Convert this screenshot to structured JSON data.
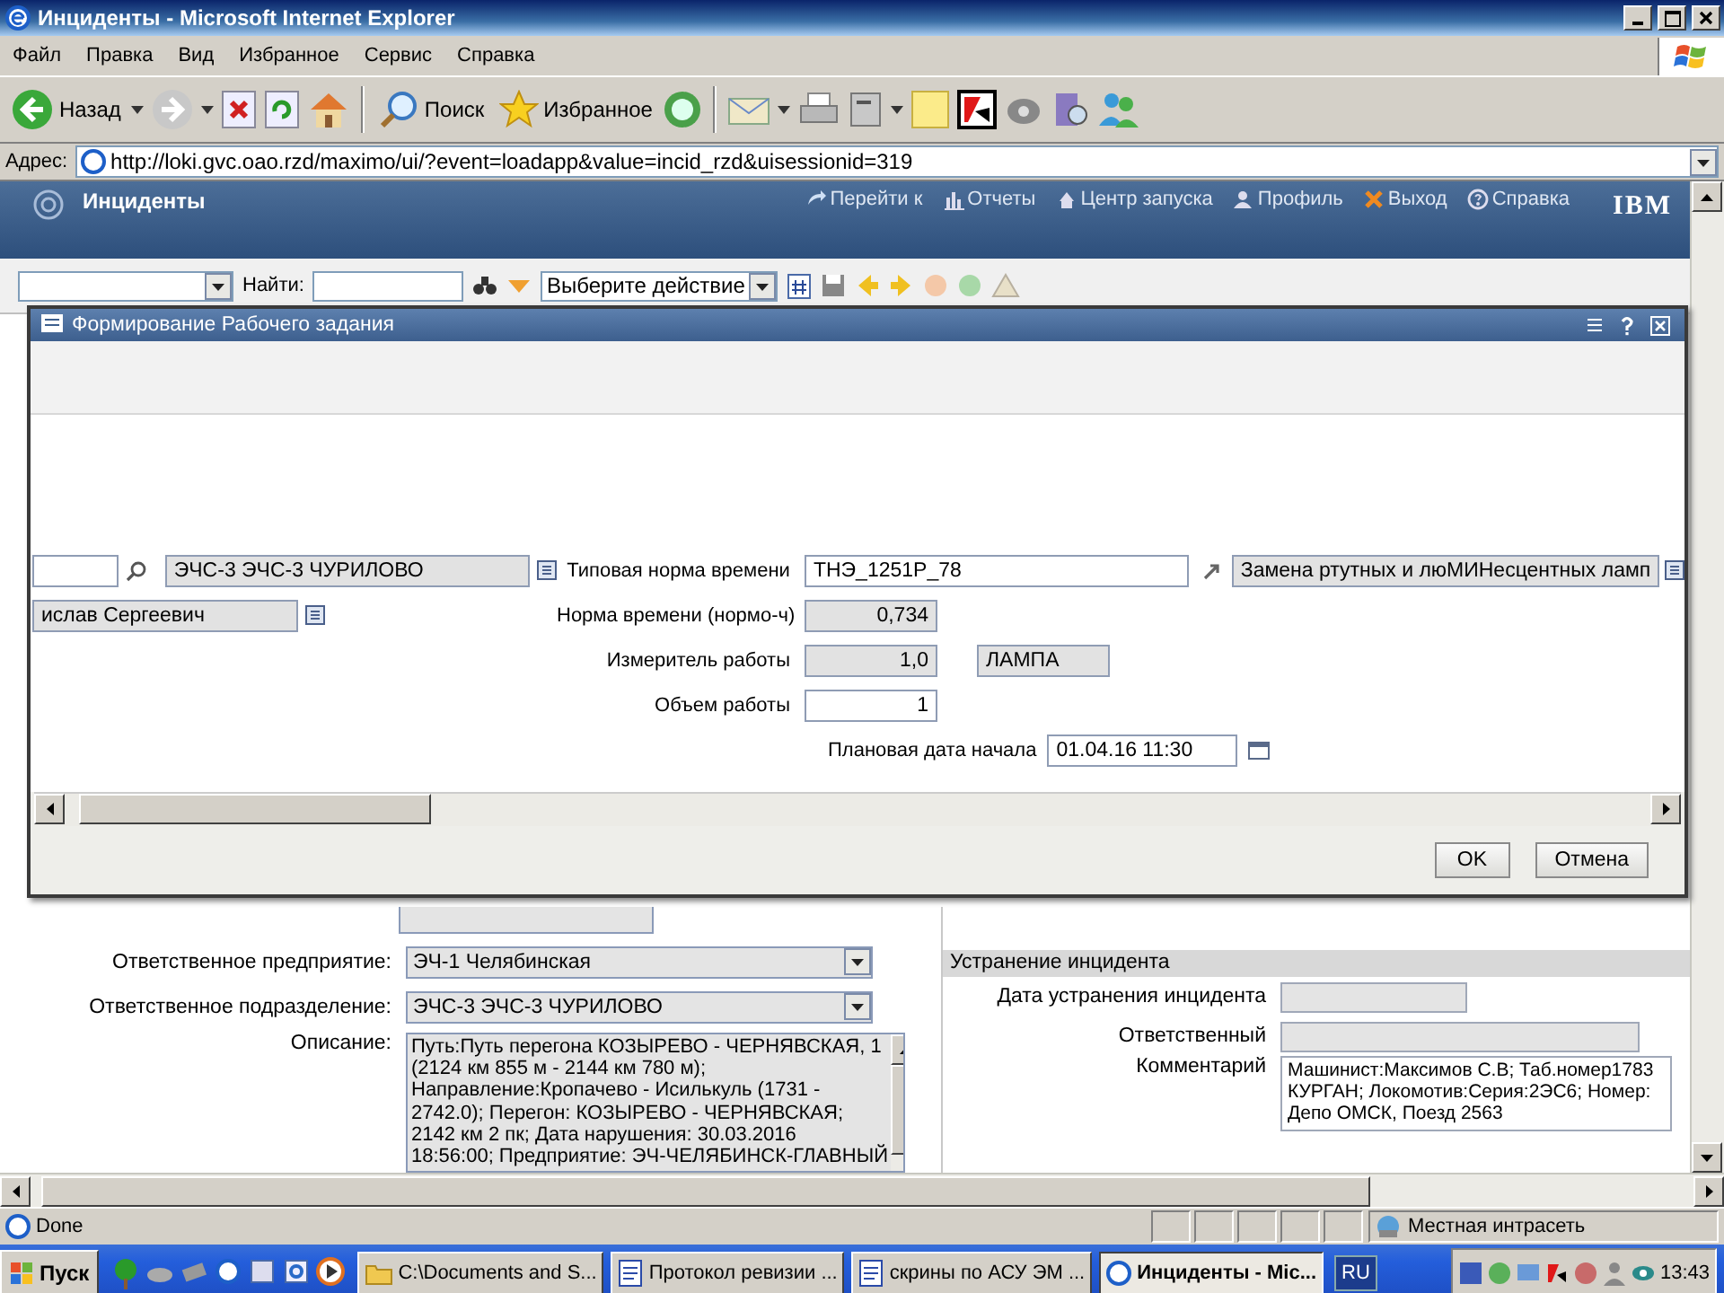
{
  "window": {
    "title": "Инциденты - Microsoft Internet Explorer"
  },
  "menu": [
    "Файл",
    "Правка",
    "Вид",
    "Избранное",
    "Сервис",
    "Справка"
  ],
  "toolbar": {
    "back": "Назад",
    "search": "Поиск",
    "favorites": "Избранное"
  },
  "address": {
    "label": "Адрес:",
    "value": "http://loki.gvc.oao.rzd/maximo/ui/?event=loadapp&value=incid_rzd&uisessionid=319"
  },
  "app_header": {
    "title": "Инциденты",
    "links": [
      "Перейти к",
      "Отчеты",
      "Центр запуска",
      "Профиль",
      "Выход",
      "Справка"
    ],
    "logo": "IBM"
  },
  "app_toolbar": {
    "find_label": "Найти:",
    "action_select": "Выберите действие"
  },
  "dialog": {
    "title": "Формирование Рабочего задания",
    "left_fields": [
      {
        "value": "ЭЧС-3 ЭЧС-3 ЧУРИЛОВО"
      },
      {
        "value": "ислав Сергеевич"
      }
    ],
    "fields": [
      {
        "label": "Типовая норма времени",
        "kind": "input",
        "value": "ТНЭ_1251Р_78",
        "extra": "Замена ртутных и люМИНесцентных ламп"
      },
      {
        "label": "Норма времени (нормо-ч)",
        "kind": "readonly",
        "value": "0,734"
      },
      {
        "label": "Измеритель работы",
        "kind": "readonly",
        "value": "1,0",
        "extra": "ЛАМПА"
      },
      {
        "label": "Объем работы",
        "kind": "input",
        "value": "1"
      }
    ],
    "start_date": {
      "label": "Плановая дата начала",
      "value": "01.04.16 11:30"
    },
    "buttons": [
      "OK",
      "Отмена"
    ]
  },
  "form": {
    "left": [
      {
        "label": "Ответственное предприятие:",
        "value": "ЭЧ-1 Челябинская"
      },
      {
        "label": "Ответственное подразделение:",
        "value": "ЭЧС-3 ЭЧС-3 ЧУРИЛОВО"
      }
    ],
    "description": {
      "label": "Описание:",
      "lines": [
        "Путь:Путь перегона КОЗЫРЕВО - ЧЕРНЯВСКАЯ, 1",
        "(2124 км 855 м - 2144 км 780 м);",
        "Направление:Кропачево - Исилькуль (1731 -",
        "2742.0); Перегон: КОЗЫРЕВО - ЧЕРНЯВСКАЯ;",
        "2142 км 2 пк; Дата нарушения: 30.03.2016",
        "18:56:00; Предприятие: ЭЧ-ЧЕЛЯБИНСК-ГЛАВНЫЙ"
      ]
    },
    "section": {
      "title": "Устранение инцидента",
      "fields": [
        {
          "label": "Дата устранения инцидента"
        },
        {
          "label": "Ответственный"
        }
      ],
      "comment": {
        "label": "Комментарий",
        "lines": [
          "Машинист:Максимов С.В; Таб.номер1783",
          "КУРГАН; Локомотив:Серия:2ЭС6; Номер:",
          "Депо ОМСК, Поезд 2563"
        ]
      }
    }
  },
  "status_bar": {
    "text": "Done",
    "zone": "Местная интрасеть"
  },
  "taskbar": {
    "start": "Пуск",
    "tasks": [
      {
        "label": "C:\\Documents and S...",
        "selected": false
      },
      {
        "label": "Протокол ревизии ...",
        "selected": false
      },
      {
        "label": "скрины по АСУ ЭМ ...",
        "selected": false
      },
      {
        "label": "Инциденты - Mic...",
        "selected": true
      }
    ],
    "lang": "RU",
    "clock": "13:43"
  }
}
